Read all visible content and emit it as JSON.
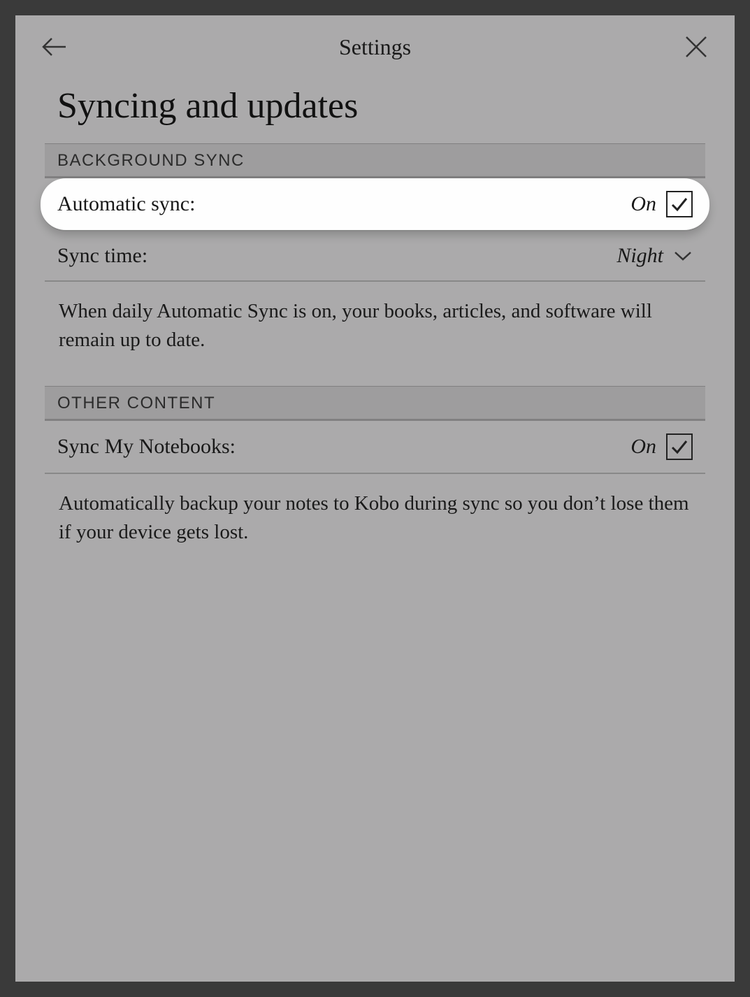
{
  "header": {
    "title": "Settings"
  },
  "page": {
    "title": "Syncing and updates"
  },
  "sections": {
    "background_sync": {
      "header": "BACKGROUND SYNC",
      "automatic_sync": {
        "label": "Automatic sync:",
        "value": "On"
      },
      "sync_time": {
        "label": "Sync time:",
        "value": "Night"
      },
      "description": "When daily Automatic Sync is on, your books, articles, and software will remain up to date."
    },
    "other_content": {
      "header": "OTHER CONTENT",
      "sync_notebooks": {
        "label": "Sync My Notebooks:",
        "value": "On"
      },
      "description": "Automatically backup your notes to Kobo during sync so you don’t lose them if your device gets lost."
    }
  }
}
